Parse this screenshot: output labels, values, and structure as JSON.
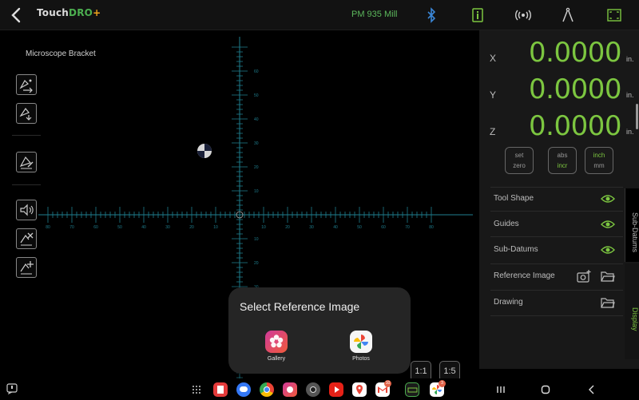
{
  "app": {
    "logo_main": "Touch",
    "logo_accent": "DRO",
    "logo_plus": "+",
    "machine": "PM 935 Mill"
  },
  "canvas": {
    "part_title": "Microscope Bracket",
    "tick_labels_x": [
      "80",
      "70",
      "60",
      "50",
      "40",
      "30",
      "20",
      "10",
      "10",
      "20",
      "30",
      "40",
      "50",
      "60",
      "70",
      "80"
    ],
    "tick_labels_y_up": [
      "60",
      "50",
      "40",
      "30",
      "20",
      "10"
    ],
    "tick_labels_y_down": [
      "10",
      "20",
      "30"
    ]
  },
  "dro": {
    "axes": [
      {
        "name": "X",
        "value": "0.0000",
        "unit": "in."
      },
      {
        "name": "Y",
        "value": "0.0000",
        "unit": "in."
      },
      {
        "name": "Z",
        "value": "0.0000",
        "unit": "in."
      }
    ],
    "set_zero": {
      "line1": "set",
      "line2": "zero"
    },
    "abs_incr": {
      "line1": "abs",
      "line2": "incr"
    },
    "inch_mm": {
      "line1": "inch",
      "line2": "mm"
    }
  },
  "display_options": [
    {
      "label": "Tool Shape"
    },
    {
      "label": "Guides"
    },
    {
      "label": "Sub-Datums"
    },
    {
      "label": "Reference Image"
    },
    {
      "label": "Drawing"
    }
  ],
  "side_tabs": {
    "sub_datums": "Sub-Datums",
    "display": "Display"
  },
  "popup": {
    "title": "Select Reference Image",
    "gallery_label": "Gallery",
    "photos_label": "Photos"
  },
  "scale": {
    "one_to_one": "1:1",
    "one_to_five": "1:5"
  },
  "dock_badges": {
    "gmail": "10",
    "photos": "3"
  },
  "colors": {
    "accent_green": "#7cc640",
    "grid_cyan": "#1f7f8f",
    "panel_bg": "#181818",
    "popup_bg": "#252525"
  }
}
